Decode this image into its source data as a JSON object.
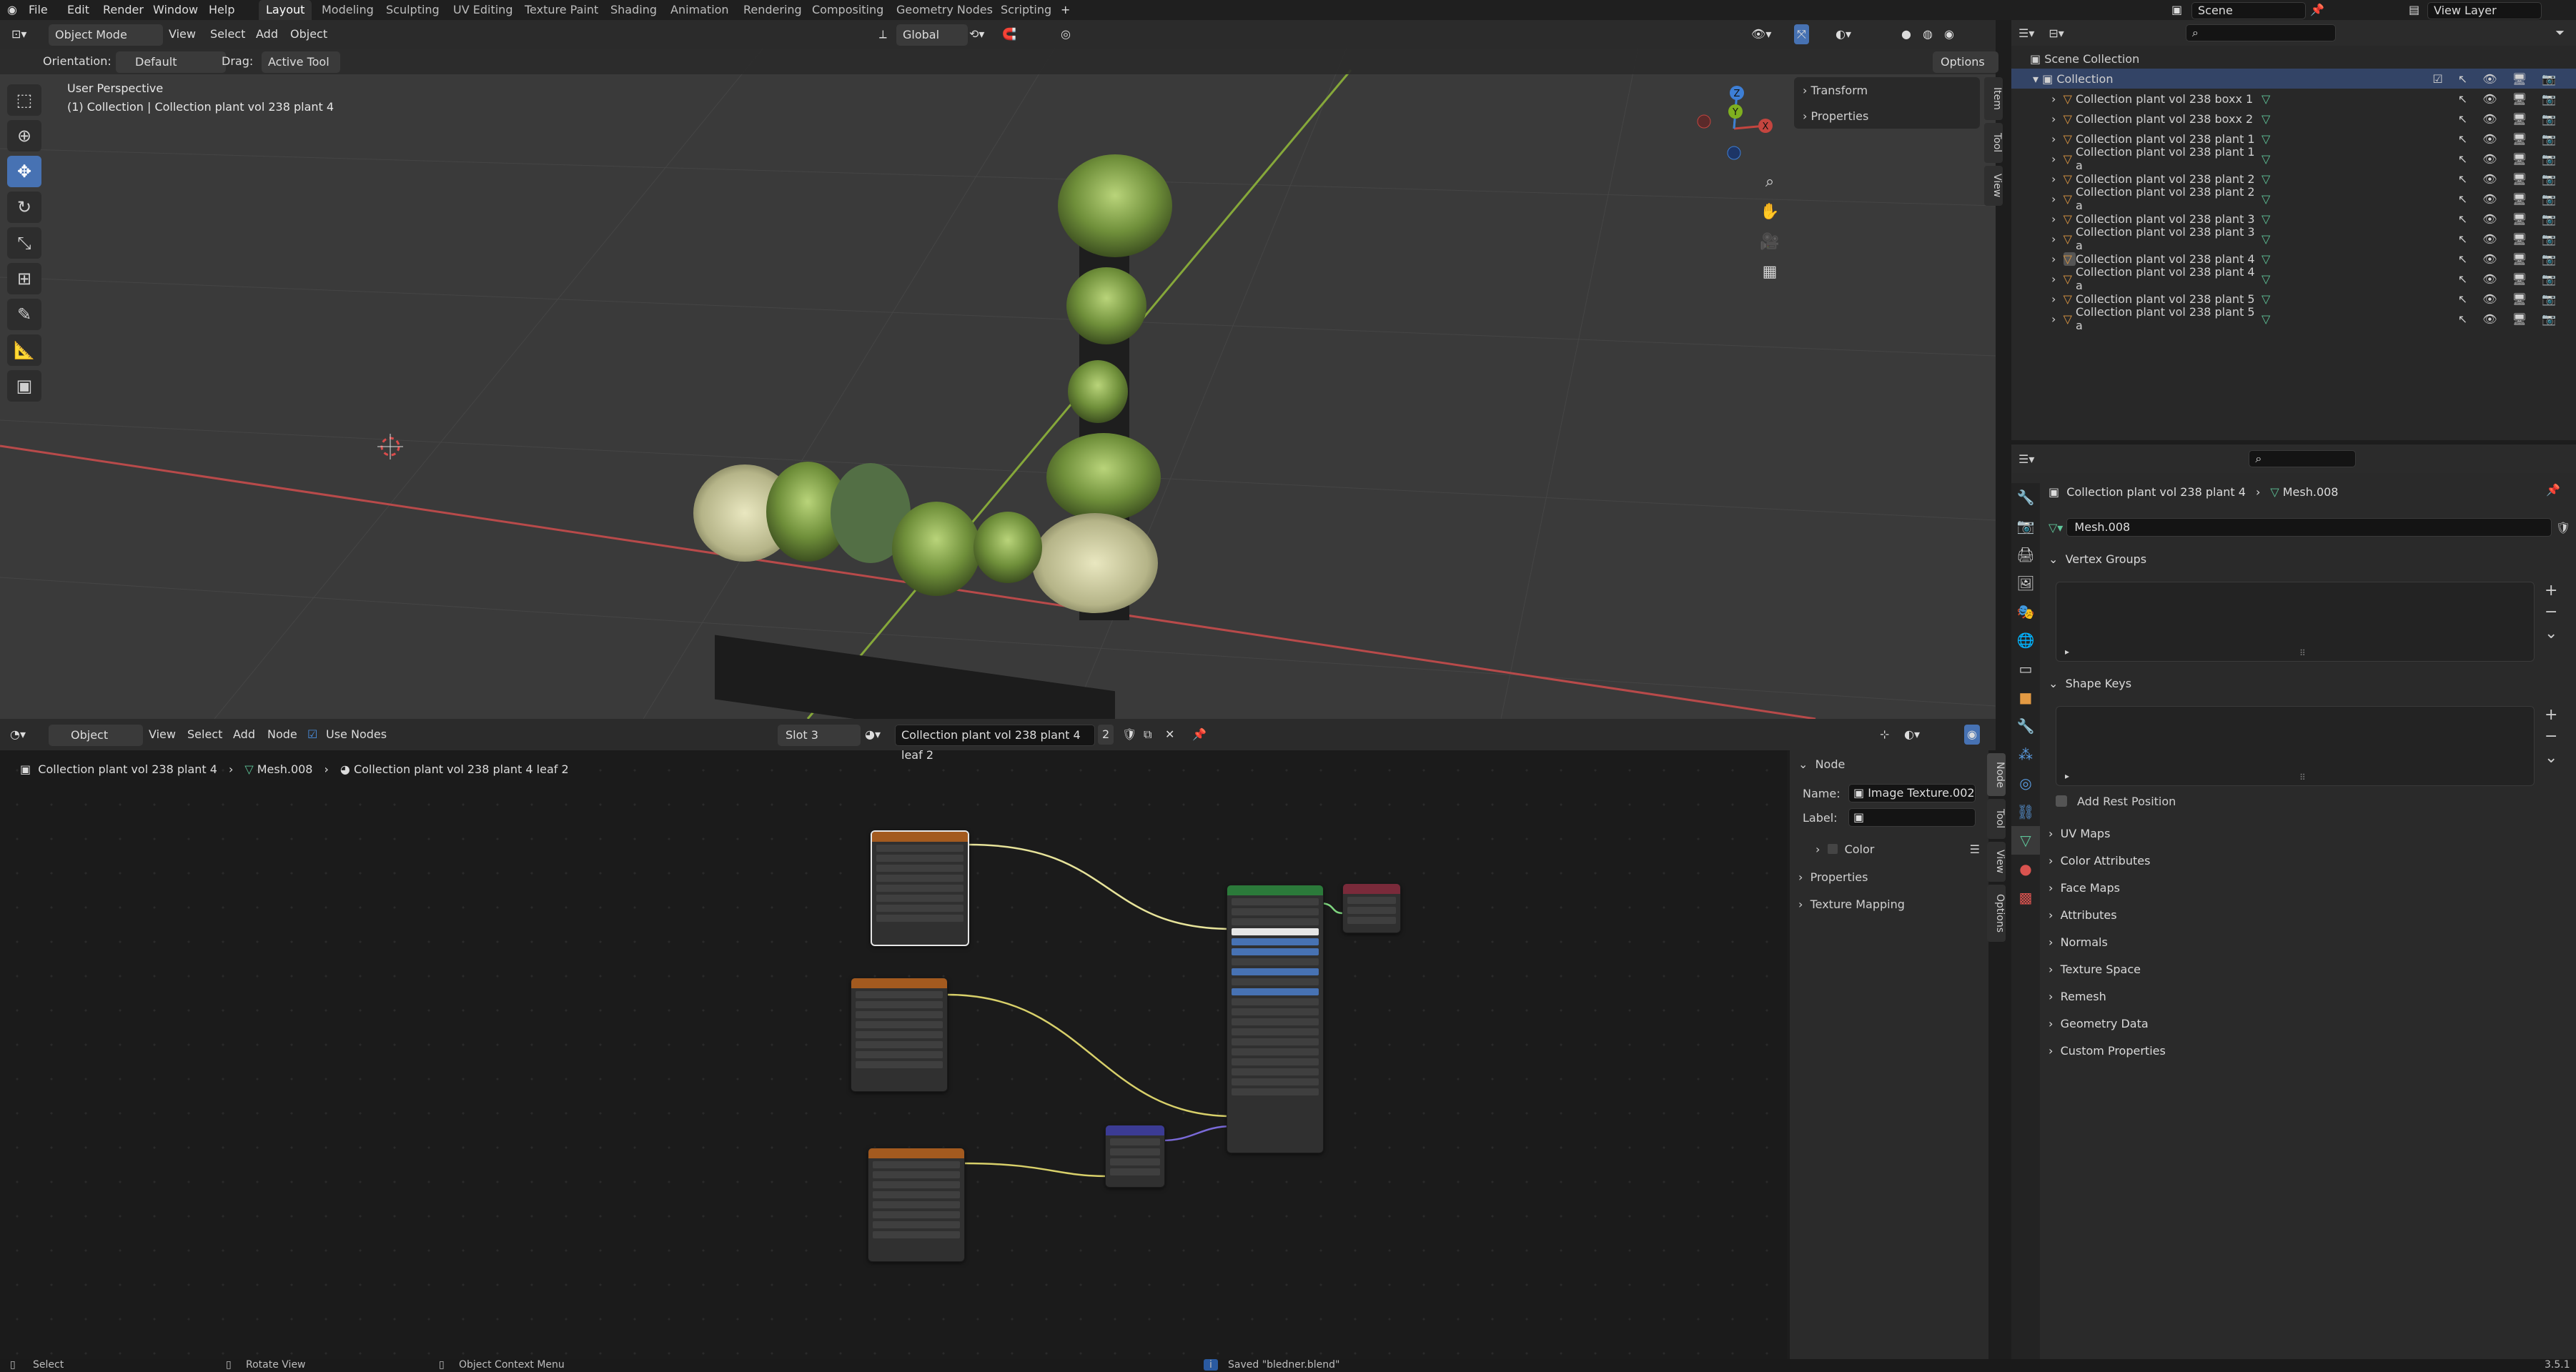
{
  "top_menu": [
    "File",
    "Edit",
    "Render",
    "Window",
    "Help"
  ],
  "workspace_tabs": [
    "Layout",
    "Modeling",
    "Sculpting",
    "UV Editing",
    "Texture Paint",
    "Shading",
    "Animation",
    "Rendering",
    "Compositing",
    "Geometry Nodes",
    "Scripting"
  ],
  "active_tab": "Layout",
  "scene_name": "Scene",
  "view_layer": "View Layer",
  "viewport": {
    "mode": "Object Mode",
    "menus": [
      "View",
      "Select",
      "Add",
      "Object"
    ],
    "orientation_label": "Orientation:",
    "orientation_value": "Default",
    "drag_label": "Drag:",
    "drag_value": "Active Tool",
    "transform_space": "Global",
    "options_label": "Options",
    "overlay_title": "User Perspective",
    "overlay_subtitle": "(1) Collection | Collection plant vol 238 plant 4",
    "n_panel": [
      "Transform",
      "Properties"
    ],
    "side_tabs": [
      "Item",
      "Tool",
      "View"
    ],
    "gizmo_axes": [
      "X",
      "Y",
      "Z"
    ]
  },
  "outliner": {
    "root": "Scene Collection",
    "collection": "Collection",
    "items": [
      "Collection plant vol 238 boxx 1",
      "Collection plant vol 238 boxx 2",
      "Collection plant vol 238 plant 1",
      "Collection plant vol 238 plant 1 a",
      "Collection plant vol 238 plant 2",
      "Collection plant vol 238 plant 2 a",
      "Collection plant vol 238 plant 3",
      "Collection plant vol 238 plant 3 a",
      "Collection plant vol 238 plant 4",
      "Collection plant vol 238 plant 4 a",
      "Collection plant vol 238 plant 5",
      "Collection plant vol 238 plant 5 a"
    ]
  },
  "properties": {
    "breadcrumb_object": "Collection plant vol 238 plant 4",
    "breadcrumb_mesh": "Mesh.008",
    "mesh_name": "Mesh.008",
    "sections_open": [
      "Vertex Groups",
      "Shape Keys"
    ],
    "add_rest_position": "Add Rest Position",
    "sections_closed": [
      "UV Maps",
      "Color Attributes",
      "Face Maps",
      "Attributes",
      "Normals",
      "Texture Space",
      "Remesh",
      "Geometry Data",
      "Custom Properties"
    ]
  },
  "node_editor": {
    "editor_type": "Object",
    "menus": [
      "View",
      "Select",
      "Add",
      "Node"
    ],
    "use_nodes": "Use Nodes",
    "slot": "Slot 3",
    "material": "Collection plant vol 238 plant 4 leaf 2",
    "user_count": "2",
    "breadcrumb": [
      "Collection plant vol 238 plant 4",
      "Mesh.008",
      "Collection plant vol 238 plant 4 leaf 2"
    ],
    "sidebar": {
      "section": "Node",
      "name_label": "Name:",
      "name_value": "Image Texture.002",
      "label_label": "Label:",
      "color_label": "Color",
      "sub_sections": [
        "Properties",
        "Texture Mapping"
      ],
      "tabs": [
        "Node",
        "Tool",
        "View",
        "Options"
      ]
    }
  },
  "status": {
    "select": "Select",
    "rotate": "Rotate View",
    "context": "Object Context Menu",
    "message": "Saved \"bledner.blend\"",
    "version": "3.5.1"
  },
  "colors": {
    "accent": "#4772b3",
    "x_axis": "#c4453f",
    "y_axis": "#7fb01f",
    "z_axis": "#3d7fd6",
    "collection_icon": "#e39a43",
    "mesh_icon": "#5fc69a"
  }
}
